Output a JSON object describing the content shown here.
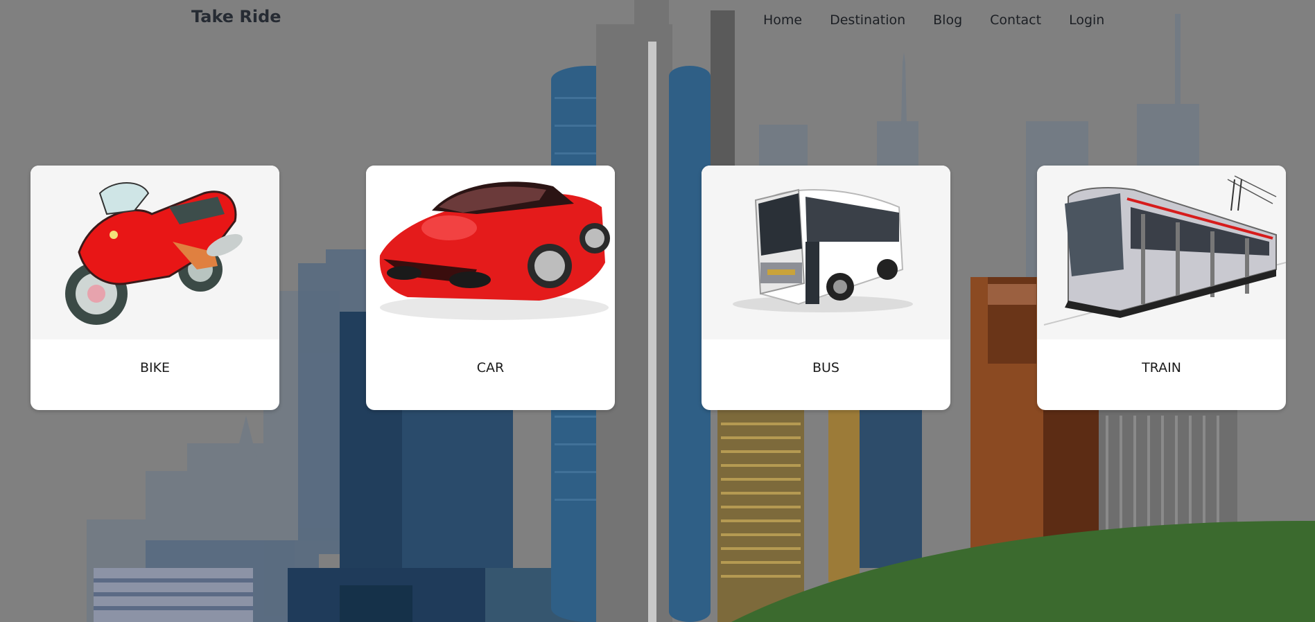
{
  "header": {
    "brand": "Take Ride",
    "nav": [
      "Home",
      "Destination",
      "Blog",
      "Contact",
      "Login"
    ]
  },
  "cards": [
    {
      "label": "BIKE",
      "image": "red-motorcycle-image"
    },
    {
      "label": "CAR",
      "image": "red-sports-car-image"
    },
    {
      "label": "BUS",
      "image": "white-coach-bus-image"
    },
    {
      "label": "TRAIN",
      "image": "tram-train-image"
    }
  ],
  "colors": {
    "overlay": "#808080",
    "card": "#ffffff",
    "card_image_bg": "#f5f5f5",
    "text_dark": "#1b1b1b",
    "hill": "#3b6a2e"
  }
}
